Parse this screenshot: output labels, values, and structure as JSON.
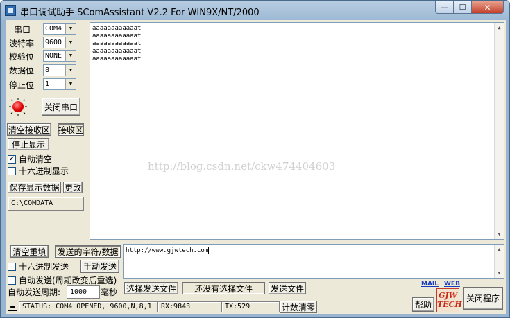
{
  "window": {
    "title": "串口调试助手 SComAssistant V2.2 For WIN9X/NT/2000",
    "min_glyph": "—",
    "max_glyph": "☐",
    "close_glyph": "✕"
  },
  "serial": {
    "port_label": "串口",
    "port_value": "COM4",
    "baud_label": "波特率",
    "baud_value": "9600",
    "parity_label": "校验位",
    "parity_value": "NONE",
    "databits_label": "数据位",
    "databits_value": "8",
    "stopbits_label": "停止位",
    "stopbits_value": "1",
    "close_port_button": "关闭串口"
  },
  "receive": {
    "clear_button": "清空接收区",
    "area_label": "接收区",
    "stop_display_button": "停止显示",
    "auto_clear_label": "自动清空",
    "auto_clear_checked": true,
    "hex_display_label": "十六进制显示",
    "hex_display_checked": false,
    "save_button": "保存显示数据",
    "change_button": "更改",
    "save_path": "C:\\COMDATA",
    "lines": [
      "aaaaaaaaaaaat",
      "aaaaaaaaaaaat",
      "aaaaaaaaaaaat",
      "aaaaaaaaaaaat",
      "aaaaaaaaaaaat"
    ]
  },
  "send": {
    "clear_resend_button": "清空重填",
    "area_label": "发送的字符/数据",
    "hex_send_label": "十六进制发送",
    "manual_send_button": "手动发送",
    "auto_send_label": "自动发送(周期改变后重选)",
    "period_label": "自动发送周期:",
    "period_value": "1000",
    "period_unit": "毫秒",
    "text": "http://www.gjwtech.com",
    "select_file_button": "选择发送文件",
    "file_status": "还没有选择文件",
    "send_file_button": "发送文件"
  },
  "footer": {
    "mail_link": "MAIL",
    "web_link": "WEB",
    "help_button": "帮助",
    "logo_text": "GJW\nTECH",
    "close_program_button": "关闭程序",
    "status_text": "STATUS: COM4 OPENED, 9600,N,8,1",
    "rx_text": "RX:9843",
    "tx_text": "TX:529",
    "reset_count_button": "计数清零"
  },
  "watermark": "http://blog.csdn.net/ckw474404603"
}
